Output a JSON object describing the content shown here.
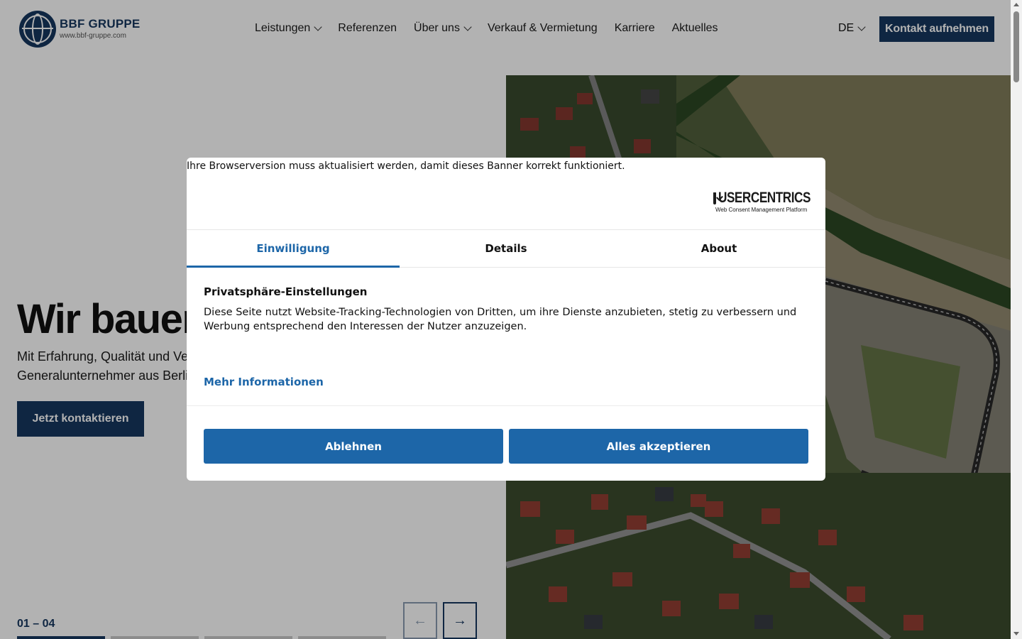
{
  "header": {
    "logo_name": "BBF GRUPPE",
    "logo_url": "www.bbf-gruppe.com",
    "nav": [
      {
        "label": "Leistungen",
        "dropdown": true
      },
      {
        "label": "Referenzen",
        "dropdown": false
      },
      {
        "label": "Über uns",
        "dropdown": true
      },
      {
        "label": "Verkauf & Vermietung",
        "dropdown": false
      },
      {
        "label": "Karriere",
        "dropdown": false
      },
      {
        "label": "Aktuelles",
        "dropdown": false
      }
    ],
    "language": "DE",
    "contact_button": "Kontakt aufnehmen"
  },
  "hero": {
    "title": "Wir bauen",
    "subtitle_line1": "Mit Erfahrung, Qualität und Ver",
    "subtitle_line2": "Generalunternehmer aus Berlin",
    "cta": "Jetzt kontaktieren",
    "slide_counter": "01 – 04",
    "slides_total": 4,
    "slide_active": 1,
    "prev_icon": "arrow-left",
    "next_icon": "arrow-right"
  },
  "consent": {
    "browser_warning": "Ihre Browserversion muss aktualisiert werden, damit dieses Banner korrekt funktioniert.",
    "brand": "USERCENTRICS",
    "brand_tagline": "Web Consent Management Platform",
    "tabs": [
      {
        "label": "Einwilligung",
        "active": true
      },
      {
        "label": "Details",
        "active": false
      },
      {
        "label": "About",
        "active": false
      }
    ],
    "title": "Privatsphäre-Einstellungen",
    "description": "Diese Seite nutzt Website-Tracking-Technologien von Dritten, um ihre Dienste anzubieten, stetig zu verbessern und Werbung entsprechend den Interessen der Nutzer anzuzeigen.",
    "more_info": "Mehr Informationen",
    "decline": "Ablehnen",
    "accept_all": "Alles akzeptieren"
  },
  "colors": {
    "brand_navy": "#16375f",
    "consent_blue": "#1d66a8",
    "overlay": "rgba(0,0,0,0.3)"
  }
}
